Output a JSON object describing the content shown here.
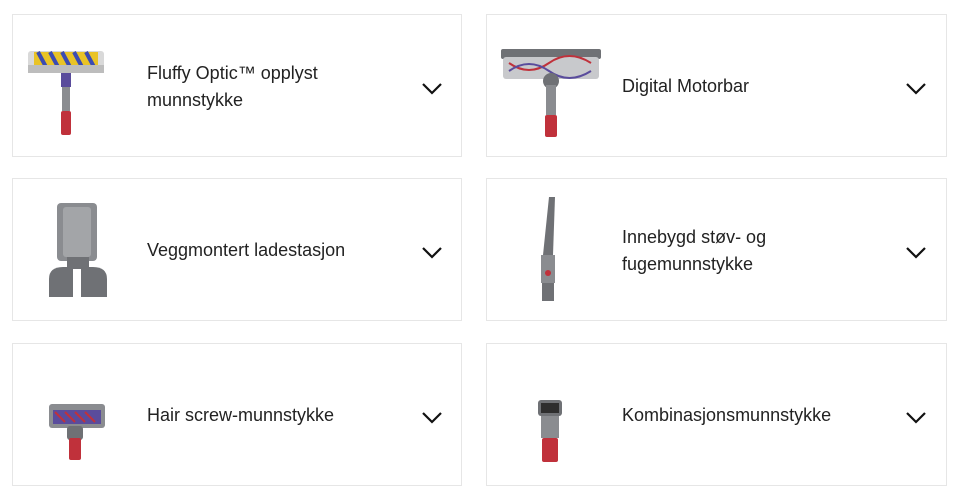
{
  "accessories": [
    {
      "label": "Fluffy Optic™ opplyst munnstykke",
      "icon": "fluffy-optic-cleaner-head-icon"
    },
    {
      "label": "Digital Motorbar",
      "icon": "digital-motorbar-head-icon"
    },
    {
      "label": "Veggmontert ladestasjon",
      "icon": "wall-dock-icon"
    },
    {
      "label": "Innebygd støv- og fugemunnstykke",
      "icon": "crevice-tool-icon"
    },
    {
      "label": "Hair screw-munnstykke",
      "icon": "hair-screw-tool-icon"
    },
    {
      "label": "Kombinasjonsmunnstykke",
      "icon": "combination-tool-icon"
    }
  ],
  "expand_icon": "chevron-down-icon",
  "colors": {
    "border": "#e6e6e6",
    "text": "#222222",
    "tool_red": "#c0313b",
    "tool_grey": "#8a8c90",
    "accent_yellow": "#e9c326",
    "accent_purple": "#5a4c9c"
  }
}
